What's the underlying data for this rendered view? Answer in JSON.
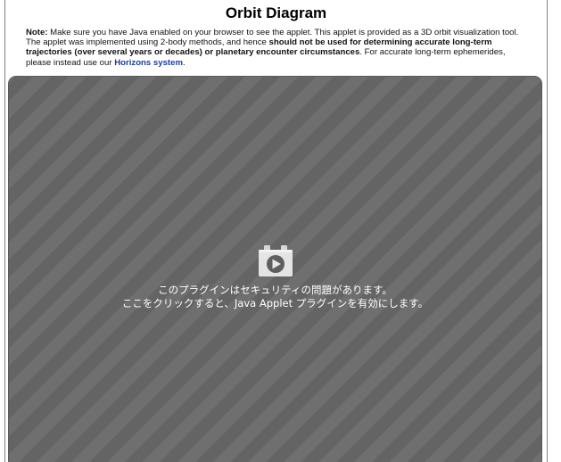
{
  "title": "Orbit Diagram",
  "note": {
    "label": "Note:",
    "text1": " Make sure you have Java enabled on your browser to see the applet. This applet is provided as a 3D orbit visualization tool. The applet was implemented using 2-body methods, and hence ",
    "bold_text": "should not be used for determining accurate long-term trajectories (over several years or decades) or planetary encounter circumstances",
    "text2": ". For accurate long-term ephemerides, please instead use our ",
    "link_text": "Horizons system",
    "text3": "."
  },
  "applet": {
    "icon": "plugin-play-icon",
    "message_line1": "このプラグインはセキュリティの問題があります。",
    "message_line2": "ここをクリックすると、Java Applet プラグインを有効にします。"
  },
  "colors": {
    "link": "#1a3ea0",
    "applet_bg": "#6b6b6b",
    "message_text": "#ffffff"
  }
}
